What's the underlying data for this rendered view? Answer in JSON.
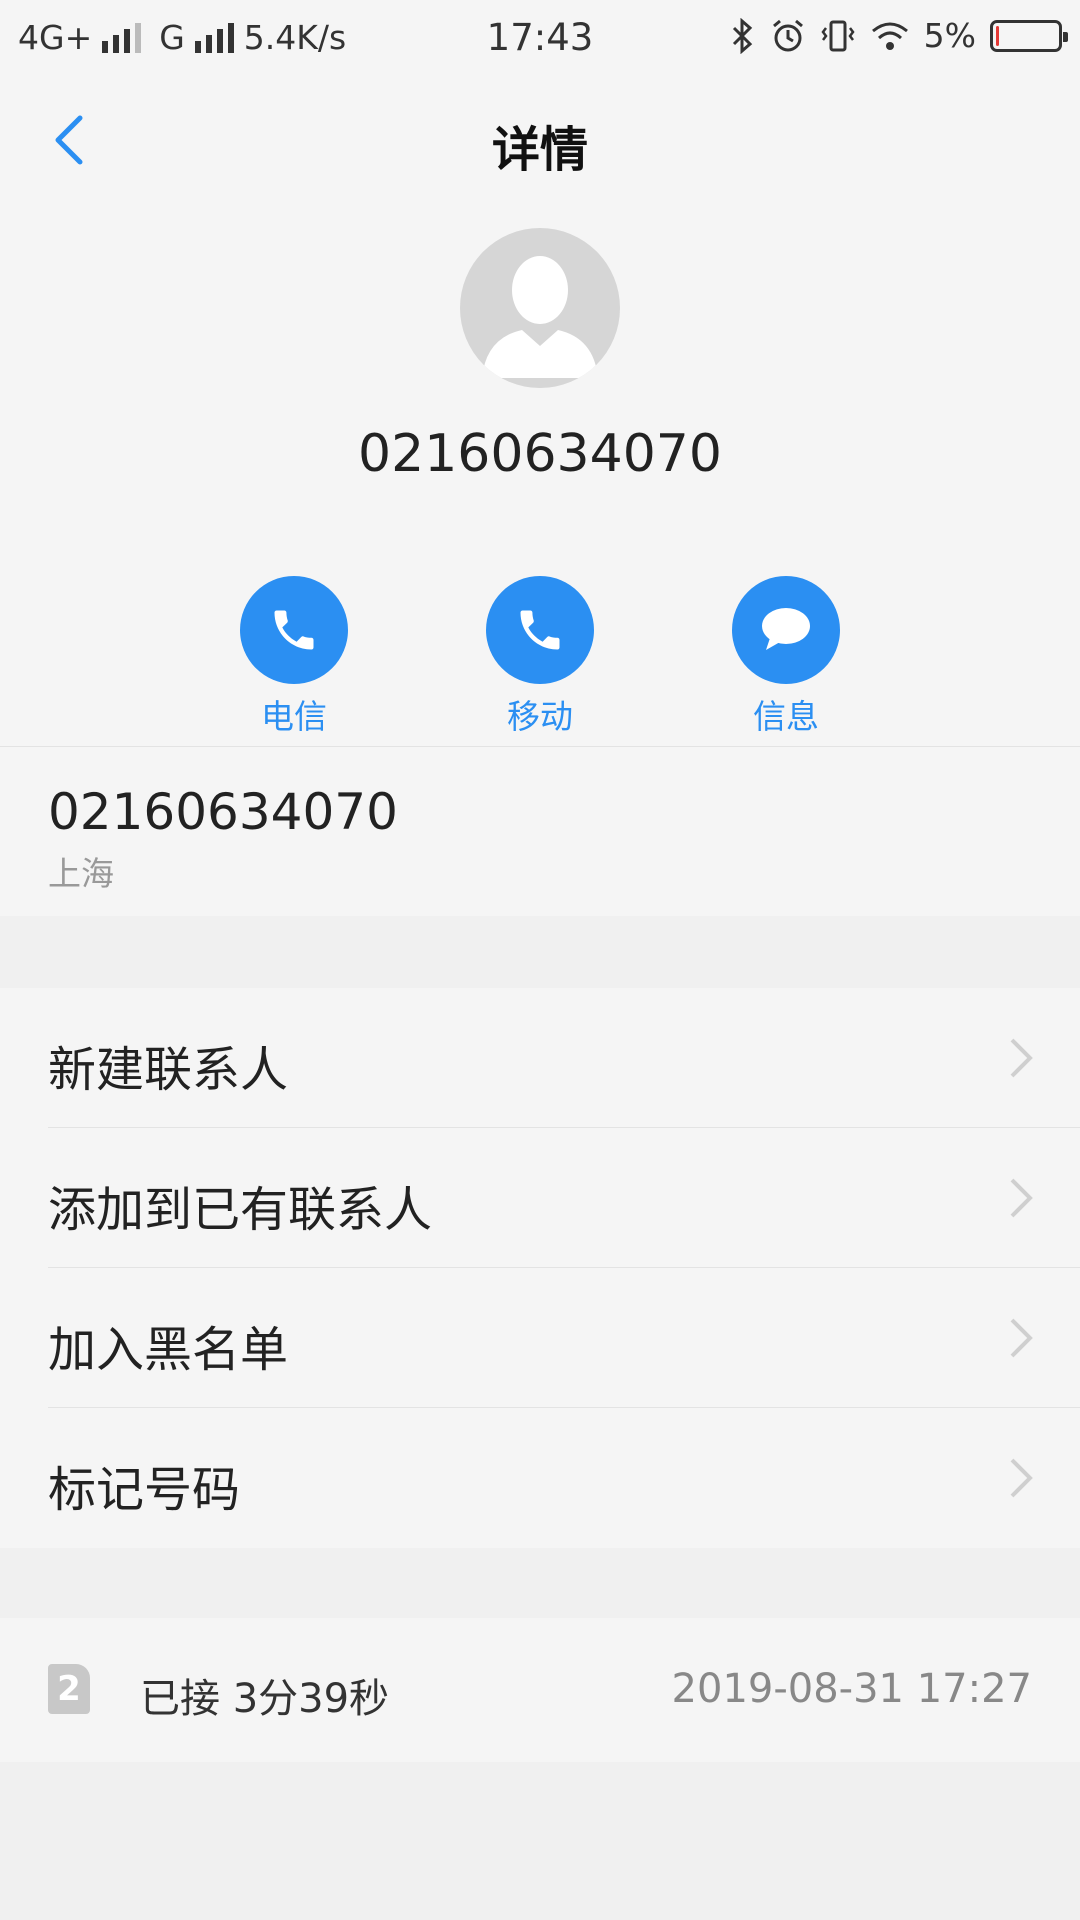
{
  "status_bar": {
    "network1": "4G+",
    "network2": "G",
    "speed": "5.4K/s",
    "time": "17:43",
    "battery_percent": "5%",
    "battery_level": 0.05
  },
  "header": {
    "title": "详情"
  },
  "contact": {
    "number": "02160634070"
  },
  "actions": [
    {
      "label": "电信",
      "icon": "phone-icon"
    },
    {
      "label": "移动",
      "icon": "phone-icon"
    },
    {
      "label": "信息",
      "icon": "message-icon"
    }
  ],
  "number_row": {
    "number": "02160634070",
    "location": "上海"
  },
  "menu": [
    {
      "label": "新建联系人"
    },
    {
      "label": "添加到已有联系人"
    },
    {
      "label": "加入黑名单"
    },
    {
      "label": "标记号码"
    }
  ],
  "call_log": {
    "sim": "2",
    "status": "已接 3分39秒",
    "datetime": "2019-08-31 17:27"
  },
  "colors": {
    "accent": "#2b8ff2",
    "battery_low": "#e53935"
  }
}
